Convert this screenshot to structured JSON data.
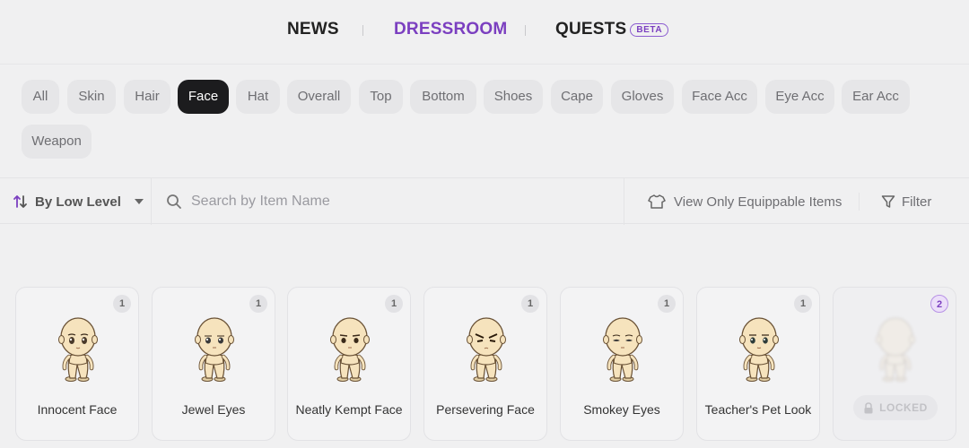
{
  "nav": {
    "items": [
      {
        "label": "NEWS"
      },
      {
        "label": "DRESSROOM"
      },
      {
        "label": "QUESTS"
      }
    ],
    "beta_badge": "BETA",
    "active": "DRESSROOM",
    "accent_color": "#7b3fc0"
  },
  "categories": {
    "items": [
      "All",
      "Skin",
      "Hair",
      "Face",
      "Hat",
      "Overall",
      "Top",
      "Bottom",
      "Shoes",
      "Cape",
      "Gloves",
      "Face Acc",
      "Eye Acc",
      "Ear Acc",
      "Weapon"
    ],
    "selected": "Face"
  },
  "toolbar": {
    "sort_label": "By Low Level",
    "search_placeholder": "Search by Item Name",
    "search_value": "",
    "equippable_label": "View Only Equippable Items",
    "filter_label": "Filter"
  },
  "items": [
    {
      "name": "Innocent Face",
      "level": "1",
      "locked": false
    },
    {
      "name": "Jewel Eyes",
      "level": "1",
      "locked": false
    },
    {
      "name": "Neatly Kempt Face",
      "level": "1",
      "locked": false
    },
    {
      "name": "Persevering Face",
      "level": "1",
      "locked": false
    },
    {
      "name": "Smokey Eyes",
      "level": "1",
      "locked": false
    },
    {
      "name": "Teacher's Pet Look",
      "level": "1",
      "locked": false
    },
    {
      "name": "",
      "level": "2",
      "locked": true,
      "lock_label": "LOCKED"
    }
  ]
}
